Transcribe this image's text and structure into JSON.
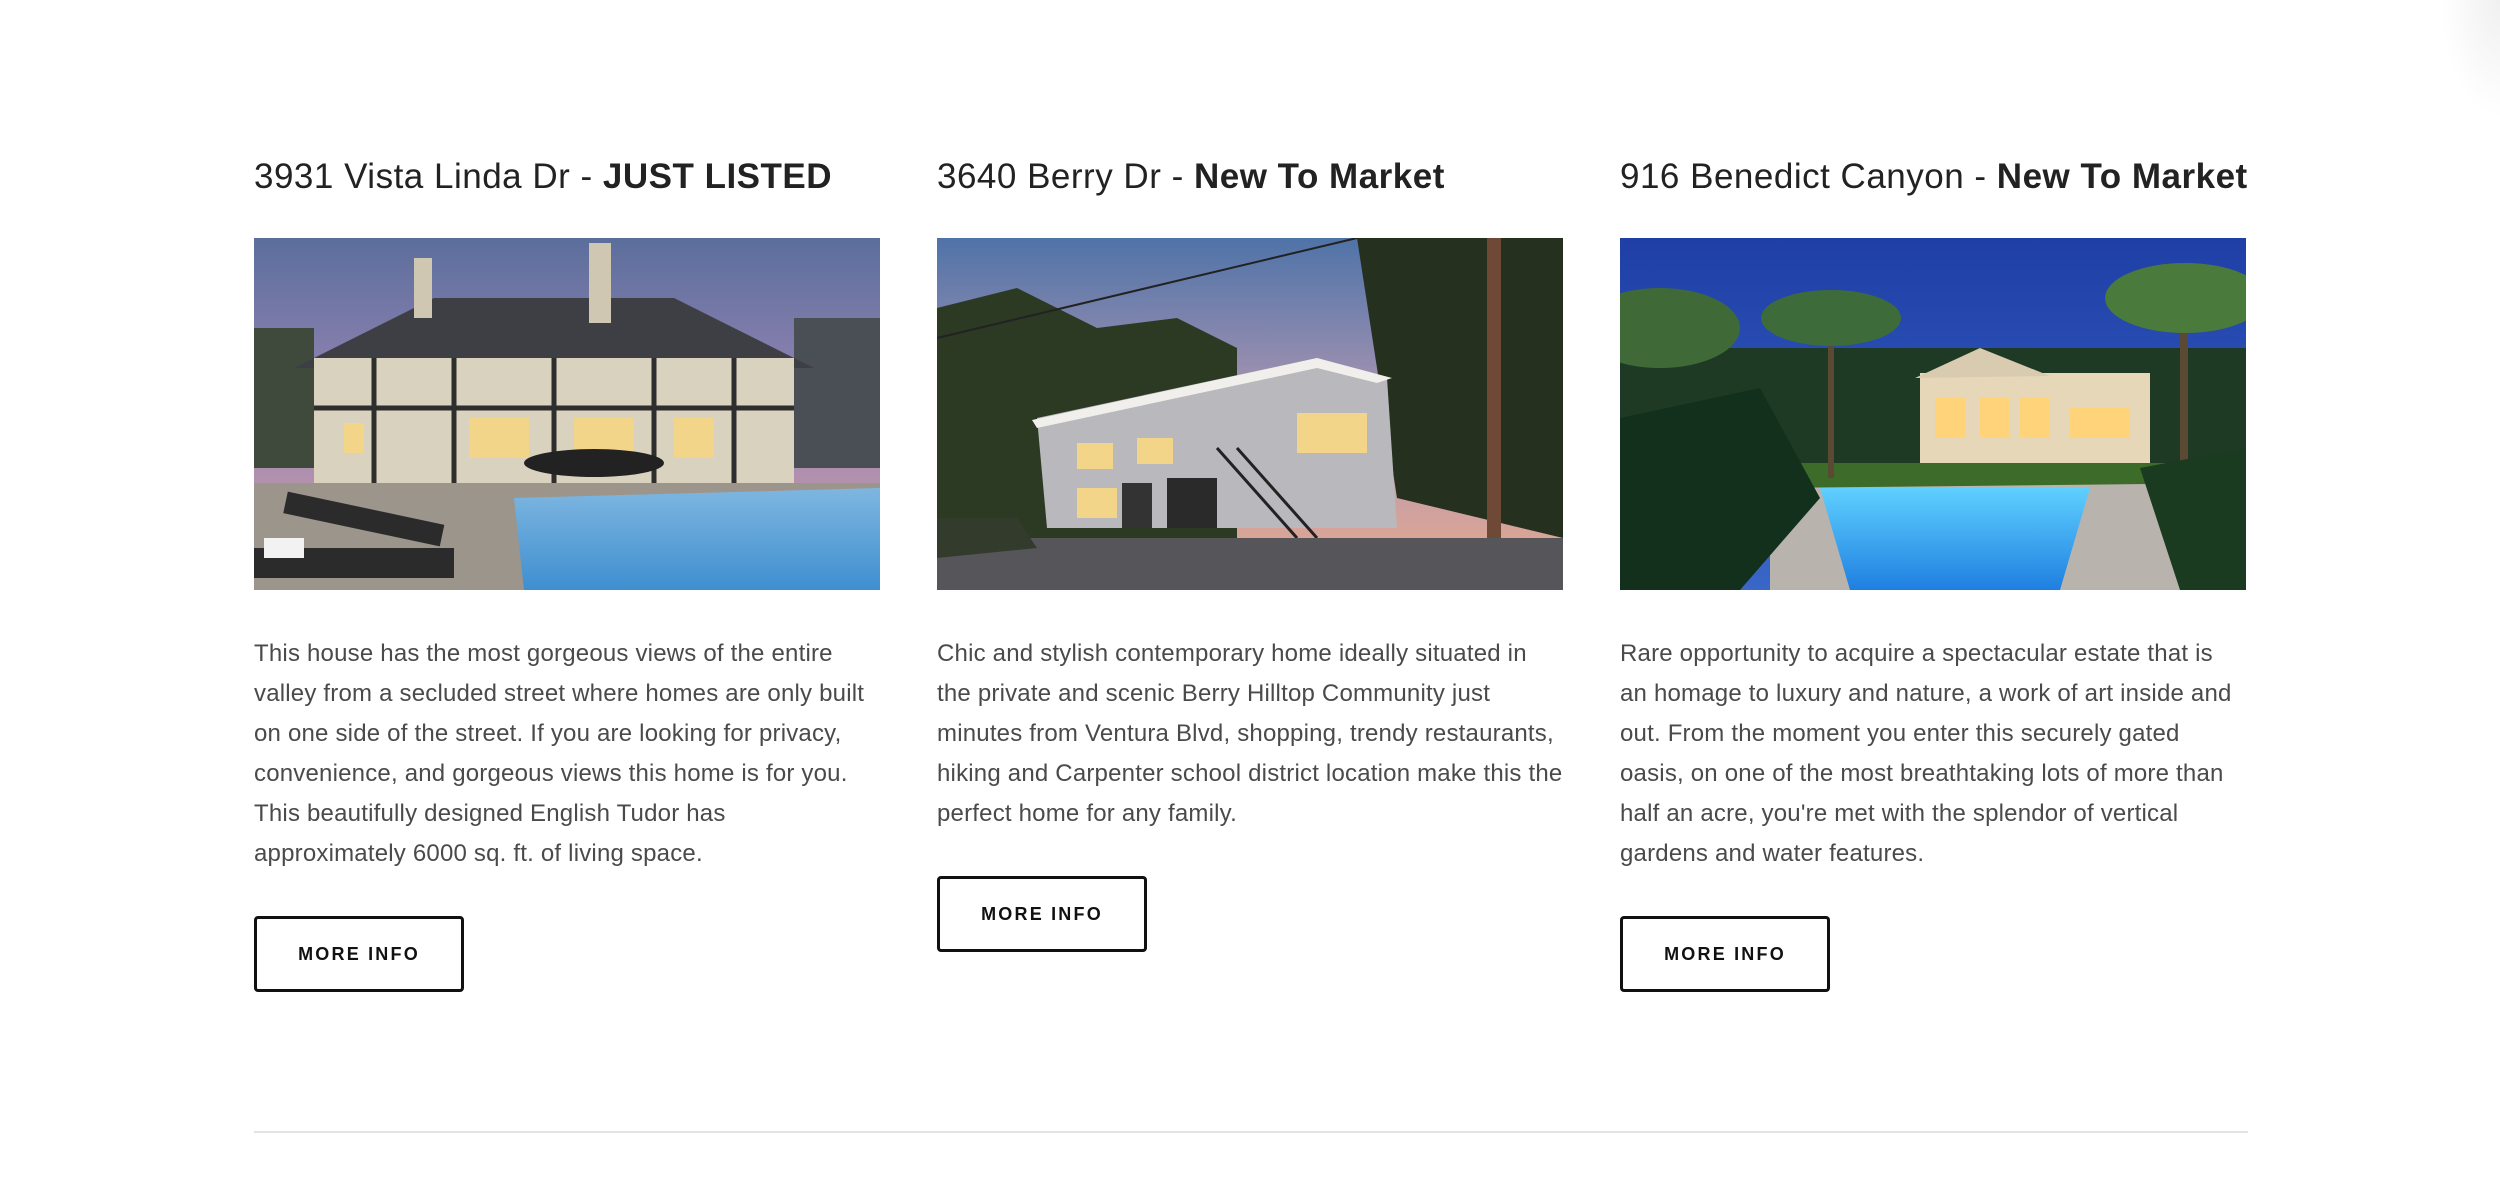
{
  "listings": [
    {
      "address": "3931 Vista Linda Dr - ",
      "tag": "JUST LISTED",
      "photo_icon": "house-photo",
      "description": "This house has the most gorgeous views of the entire valley from a secluded street where homes are only built on one side of the street. If you are looking for privacy, convenience, and gorgeous views this home is for you. This beautifully designed English Tudor has approximately 6000 sq. ft. of living space.",
      "button_label": "MORE INFO"
    },
    {
      "address": "3640 Berry Dr - ",
      "tag": "New To Market",
      "photo_icon": "house-photo",
      "description": "Chic and stylish contemporary home ideally situated in the private and scenic Berry Hilltop Community just minutes from Ventura Blvd, shopping, trendy restaurants, hiking and Carpenter school district location make this the perfect home for any family.",
      "button_label": "MORE INFO"
    },
    {
      "address": "916 Benedict Canyon - ",
      "tag": "New To Market",
      "photo_icon": "estate-photo",
      "description": "Rare opportunity to acquire a spectacular estate that is an homage to luxury and nature, a work of art inside and out. From the moment you enter this securely gated oasis, on one of the most breathtaking lots of more than half an acre, you're met with the splendor of vertical gardens and water features.",
      "button_label": "MORE INFO"
    }
  ]
}
